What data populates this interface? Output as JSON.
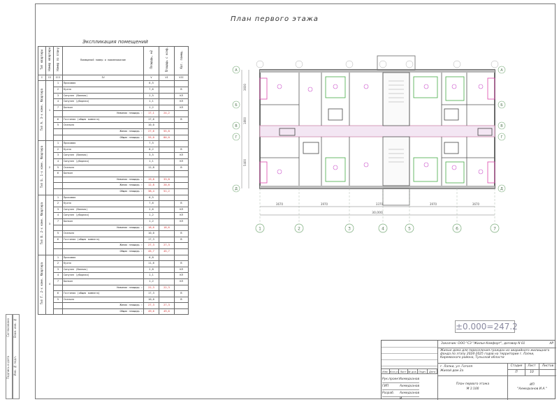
{
  "sheet": {
    "title": "План первого этажа",
    "elevation": "±0.000=247.2"
  },
  "explication": {
    "title": "Экспликация помещений",
    "headers": [
      "Тип квартиры",
      "Номер квартиры",
      "Номер по плану",
      "Помещений номер и наименование",
      "Площадь, м2",
      "Площадь с коэф.",
      "Кат. помещ."
    ],
    "header_nums": [
      "I",
      "II",
      "III",
      "IV",
      "V",
      "VI",
      "VII"
    ],
    "groups": [
      {
        "type": "Тип А. 3-х комн. Квартира",
        "num": "1",
        "rows": [
          {
            "no": "1",
            "name": "Прихожая",
            "area": "6,5",
            "area2": "",
            "loc": "",
            "red": false
          },
          {
            "no": "2",
            "name": "Кухня",
            "area": "7,6",
            "area2": "",
            "loc": "В",
            "red": false
          },
          {
            "no": "3",
            "name": "Санузел (Ванная)",
            "area": "2,5",
            "area2": "",
            "loc": "КЛ",
            "red": false
          },
          {
            "no": "4",
            "name": "Санузел (уборная)",
            "area": "1,1",
            "area2": "",
            "loc": "КЛ",
            "red": false
          },
          {
            "no": "7",
            "name": "Балкон",
            "area": "1,2",
            "area2": "",
            "loc": "КЛ",
            "red": false
          },
          {
            "no": "",
            "name": "Нежилая площадь :",
            "area": "17,1",
            "area2": "24,2",
            "loc": "",
            "red": true
          },
          {
            "no": "6",
            "name": "Гостиная (общая комната)",
            "area": "17,6",
            "area2": "",
            "loc": "В",
            "red": false
          },
          {
            "no": "5",
            "name": "Спальня",
            "area": "10,0",
            "area2": "",
            "loc": "",
            "red": false
          },
          {
            "no": "",
            "name": "Жилая площадь :",
            "area": "27,6",
            "area2": "55,8",
            "loc": "",
            "red": true
          },
          {
            "no": "",
            "name": "Общая площадь :",
            "area": "55,0",
            "area2": "80,0",
            "loc": "",
            "red": true
          }
        ]
      },
      {
        "type": "Тип Б. 1-х комн. Квартира",
        "num": "2",
        "rows": [
          {
            "no": "1",
            "name": "Прихожая",
            "area": "7,5",
            "area2": "",
            "loc": "",
            "red": false
          },
          {
            "no": "2",
            "name": "Кухня",
            "area": "8,2",
            "area2": "",
            "loc": "В",
            "red": false
          },
          {
            "no": "3",
            "name": "Санузел (Ванная)",
            "area": "3,5",
            "area2": "",
            "loc": "КЛ",
            "red": false
          },
          {
            "no": "4",
            "name": "Санузел (уборная)",
            "area": "1,1",
            "area2": "",
            "loc": "КЛ",
            "red": false
          },
          {
            "no": "5",
            "name": "Спальня",
            "area": "12,8",
            "area2": "",
            "loc": "В",
            "red": false
          },
          {
            "no": "6",
            "name": "Балкон",
            "area": "",
            "area2": "",
            "loc": "",
            "red": false
          },
          {
            "no": "",
            "name": "Нежилая площадь :",
            "area": "19,8",
            "area2": "33,8",
            "loc": "",
            "red": true
          },
          {
            "no": "",
            "name": "Жилая площадь :",
            "area": "12,8",
            "area2": "20,6",
            "loc": "",
            "red": true
          },
          {
            "no": "",
            "name": "Общая площадь :",
            "area": "38,4",
            "area2": "51,2",
            "loc": "",
            "red": true
          }
        ]
      },
      {
        "type": "Тип В. 2-х комн. Квартира",
        "num": "3",
        "rows": [
          {
            "no": "1",
            "name": "Прихожая",
            "area": "6,5",
            "area2": "",
            "loc": "",
            "red": false
          },
          {
            "no": "2",
            "name": "Кухня",
            "area": "7,6",
            "area2": "",
            "loc": "В",
            "red": false
          },
          {
            "no": "3",
            "name": "Санузел (Ванная)",
            "area": "2,6",
            "area2": "",
            "loc": "КЛ",
            "red": false
          },
          {
            "no": "4",
            "name": "Санузел (уборная)",
            "area": "1,2",
            "area2": "",
            "loc": "КЛ",
            "red": false
          },
          {
            "no": "7",
            "name": "Балкон",
            "area": "1,2",
            "area2": "",
            "loc": "КЛ",
            "red": false
          },
          {
            "no": "",
            "name": "Нежилая площадь :",
            "area": "18,6",
            "area2": "18,6",
            "loc": "",
            "red": true
          },
          {
            "no": "5",
            "name": "Спальня",
            "area": "10,0",
            "area2": "",
            "loc": "В",
            "red": false
          },
          {
            "no": "6",
            "name": "Гостиная (общая комната)",
            "area": "17,3",
            "area2": "",
            "loc": "В",
            "red": false
          },
          {
            "no": "",
            "name": "Жилая площадь :",
            "area": "27,3",
            "area2": "27,3",
            "loc": "",
            "red": true
          },
          {
            "no": "",
            "name": "Общая площадь :",
            "area": "45,7",
            "area2": "45,7",
            "loc": "",
            "red": true
          }
        ]
      },
      {
        "type": "Тип Г. 2-х комн. Квартира",
        "num": "4",
        "rows": [
          {
            "no": "1",
            "name": "Прихожая",
            "area": "6,8",
            "area2": "",
            "loc": "",
            "red": false
          },
          {
            "no": "2",
            "name": "Кухня",
            "area": "11,6",
            "area2": "",
            "loc": "В",
            "red": false
          },
          {
            "no": "3",
            "name": "Санузел (Ванная)",
            "area": "2,8",
            "area2": "",
            "loc": "КЛ",
            "red": false
          },
          {
            "no": "4",
            "name": "Санузел (уборная)",
            "area": "1,1",
            "area2": "",
            "loc": "КЛ",
            "red": false
          },
          {
            "no": "7",
            "name": "Балкон",
            "area": "1,2",
            "area2": "",
            "loc": "КЛ",
            "red": false
          },
          {
            "no": "",
            "name": "Нежилая площадь :",
            "area": "22,3",
            "area2": "22,3",
            "loc": "",
            "red": true
          },
          {
            "no": "6",
            "name": "Гостиная (общая комната)",
            "area": "17,3",
            "area2": "",
            "loc": "В",
            "red": false
          },
          {
            "no": "5",
            "name": "Спальня",
            "area": "10,0",
            "area2": "",
            "loc": "В",
            "red": false
          },
          {
            "no": "",
            "name": "Жилая площадь :",
            "area": "27,3",
            "area2": "27,3",
            "loc": "",
            "red": true
          },
          {
            "no": "",
            "name": "Общая площадь :",
            "area": "49,6",
            "area2": "49,6",
            "loc": "",
            "red": true
          }
        ]
      }
    ]
  },
  "plan": {
    "axes_x": [
      "1",
      "2",
      "3",
      "4",
      "5",
      "6",
      "7"
    ],
    "axes_y": [
      "А",
      "Б",
      "В",
      "Г",
      "Д"
    ],
    "dims_bottom": [
      "3670",
      "3970",
      "3370",
      "3970",
      "3670"
    ],
    "dim_total": "30,000",
    "dims_left": [
      "3600",
      "1800",
      "5400"
    ]
  },
  "titleblock": {
    "customer": "Заказчик: ООО \"СЗ \"Жилье Комфорт\", договор N 01",
    "stage_code": "АР",
    "project": "Жилые дома для переселения граждан из аварийного жилищного фонда по этапу 2024-2025 годов на территории г. Лапки, Киреевского района, Тульской области",
    "address": "г. Лапки, ул. Гоголя",
    "building": "Жилой дом 2а",
    "drawing": "План первого этажа",
    "scale": "М 1:100",
    "col_heads": [
      "Изм.",
      "Кол.уч",
      "Лист",
      "№ док.",
      "Подп.",
      "Дата"
    ],
    "roles": [
      {
        "role": "Рук.проект.",
        "name": "Ахмедханов"
      },
      {
        "role": "ГИП",
        "name": "Ахмедханов"
      },
      {
        "role": "Разраб.",
        "name": "Ахмедханов И."
      }
    ],
    "stage_heads": [
      "Стадия",
      "Лист",
      "Листов"
    ],
    "stage": "П",
    "sheet_no": "10",
    "sheets": "",
    "org_code": "ИП",
    "org": "\"Ахмедханов И.А.\""
  },
  "side_strip": [
    "Инв. № подл.",
    "Подпись и дата",
    "Взам. инв. №",
    "Согласовано"
  ]
}
